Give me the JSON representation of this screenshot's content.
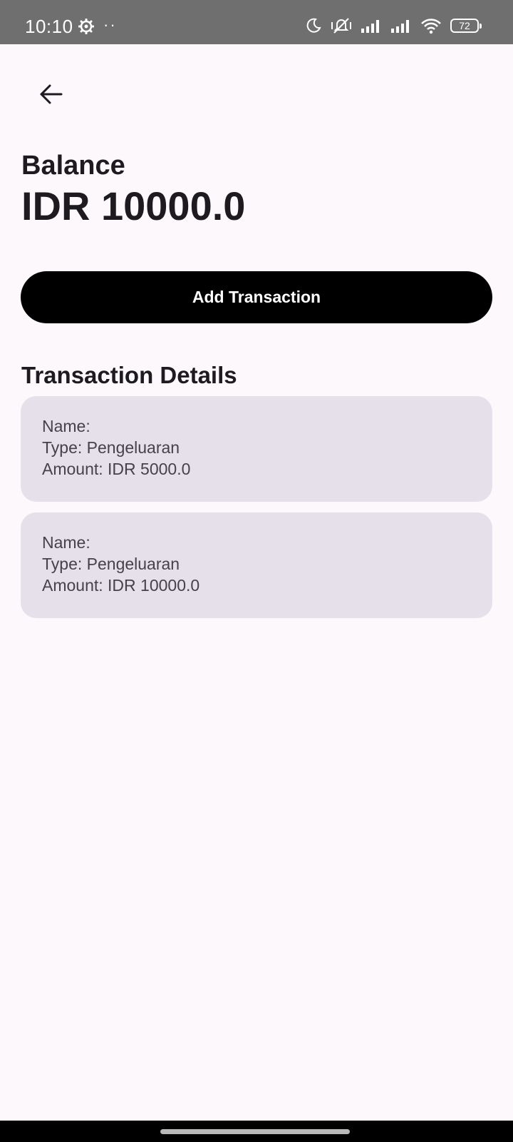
{
  "status_bar": {
    "time": "10:10",
    "dots": "··",
    "battery_level": "72",
    "icons": [
      "settings-gear-icon",
      "moon-icon",
      "muted-vibrate-icon",
      "signal-icon",
      "signal-icon",
      "wifi-icon",
      "battery-icon"
    ]
  },
  "header": {
    "back_icon": "arrow-left-icon"
  },
  "balance": {
    "label": "Balance",
    "value": "IDR 10000.0"
  },
  "actions": {
    "add_transaction_label": "Add Transaction"
  },
  "transactions": {
    "title": "Transaction Details",
    "items": [
      {
        "name": "Name:",
        "type": "Type: Pengeluaran",
        "amount": "Amount: IDR 5000.0"
      },
      {
        "name": "Name:",
        "type": "Type: Pengeluaran",
        "amount": "Amount: IDR 10000.0"
      }
    ]
  },
  "colors": {
    "background": "#fdf8fc",
    "status_bar": "#6f6f6f",
    "button": "#000000",
    "card": "#e6e0eb",
    "text": "#1d1b20"
  }
}
